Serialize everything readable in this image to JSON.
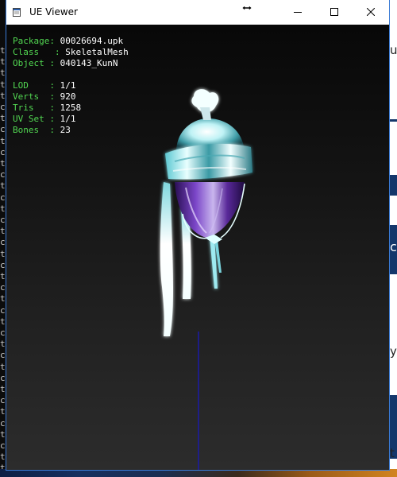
{
  "window": {
    "title": "UE Viewer"
  },
  "background": {
    "console_letters": [
      "t",
      "t",
      "t",
      "t",
      "t",
      "c",
      "t",
      "c",
      "t",
      "c",
      "t",
      "c",
      "t",
      "c",
      "t",
      "c",
      "t",
      "c",
      "t",
      "c",
      "t",
      "c",
      "t",
      "c",
      "t",
      "c",
      "t",
      "c",
      "t",
      "c",
      "t",
      "c",
      "t",
      "c",
      "t",
      "c",
      "t",
      "t"
    ],
    "app_letters": [
      "u",
      "c",
      "y",
      "t"
    ],
    "app_letters_dark": [
      "c"
    ]
  },
  "info": {
    "package": {
      "label": "Package",
      "value": "00026694.upk"
    },
    "class": {
      "label": "Class",
      "value": "SkeletalMesh"
    },
    "object": {
      "label": "Object",
      "value": "040143_KunN"
    },
    "lod": {
      "label": "LOD",
      "value": "1/1"
    },
    "verts": {
      "label": "Verts",
      "value": "920"
    },
    "tris": {
      "label": "Tris",
      "value": "1258"
    },
    "uvset": {
      "label": "UV Set",
      "value": "1/1"
    },
    "bones": {
      "label": "Bones",
      "value": "23"
    }
  },
  "colors": {
    "label_green": "#52d852",
    "axis_blue": "#1a1aa8",
    "mesh_cyan": "#8fe6ec",
    "mesh_purple": "#5a2a9a"
  },
  "icons": {
    "app": "ue-viewer-app-icon",
    "resize": "horizontal-resize-cursor-icon",
    "minimize": "minimize-icon",
    "maximize": "maximize-icon",
    "close": "close-icon"
  }
}
